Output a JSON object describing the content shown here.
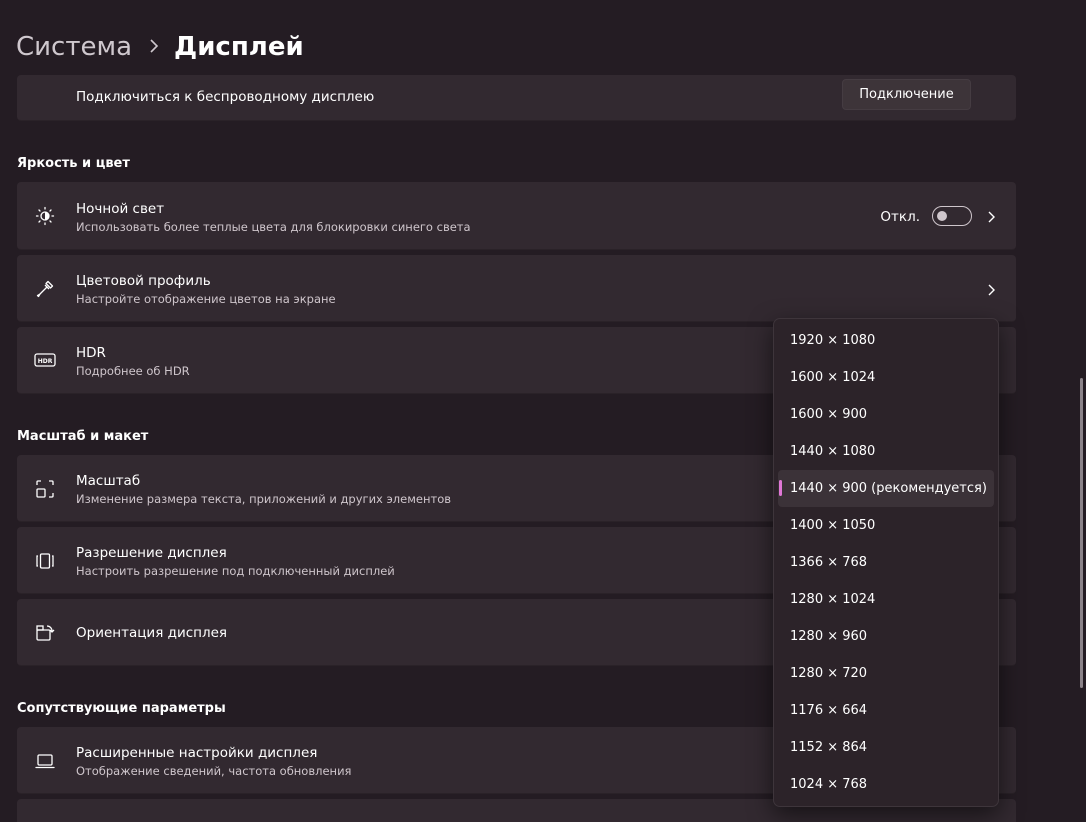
{
  "breadcrumb": {
    "parent": "Система",
    "current": "Дисплей"
  },
  "wireless": {
    "title": "Подключиться к беспроводному дисплею",
    "button": "Подключение"
  },
  "sections": {
    "brightness": "Яркость и цвет",
    "scale": "Масштаб и макет",
    "related": "Сопутствующие параметры"
  },
  "night_light": {
    "title": "Ночной свет",
    "subtitle": "Использовать более теплые цвета для блокировки синего света",
    "state": "Откл."
  },
  "color_profile": {
    "title": "Цветовой профиль",
    "subtitle": "Настройте отображение цветов на экране"
  },
  "hdr": {
    "title": "HDR",
    "link": "Подробнее об HDR"
  },
  "scale": {
    "title": "Масштаб",
    "subtitle": "Изменение размера текста, приложений и других элементов"
  },
  "resolution": {
    "title": "Разрешение дисплея",
    "subtitle": "Настроить разрешение под подключенный дисплей"
  },
  "orientation": {
    "title": "Ориентация дисплея"
  },
  "advanced": {
    "title": "Расширенные настройки дисплея",
    "subtitle": "Отображение сведений, частота обновления"
  },
  "resolution_options": [
    "1920 × 1080",
    "1600 × 1024",
    "1600 × 900",
    "1440 × 1080",
    "1440 × 900 (рекомендуется)",
    "1400 × 1050",
    "1366 × 768",
    "1280 × 1024",
    "1280 × 960",
    "1280 × 720",
    "1176 × 664",
    "1152 × 864",
    "1024 × 768"
  ],
  "selected_resolution": "1440 × 900 (рекомендуется)",
  "colors": {
    "accent": "#e58fdc",
    "background": "#241c23",
    "card": "#322930"
  }
}
